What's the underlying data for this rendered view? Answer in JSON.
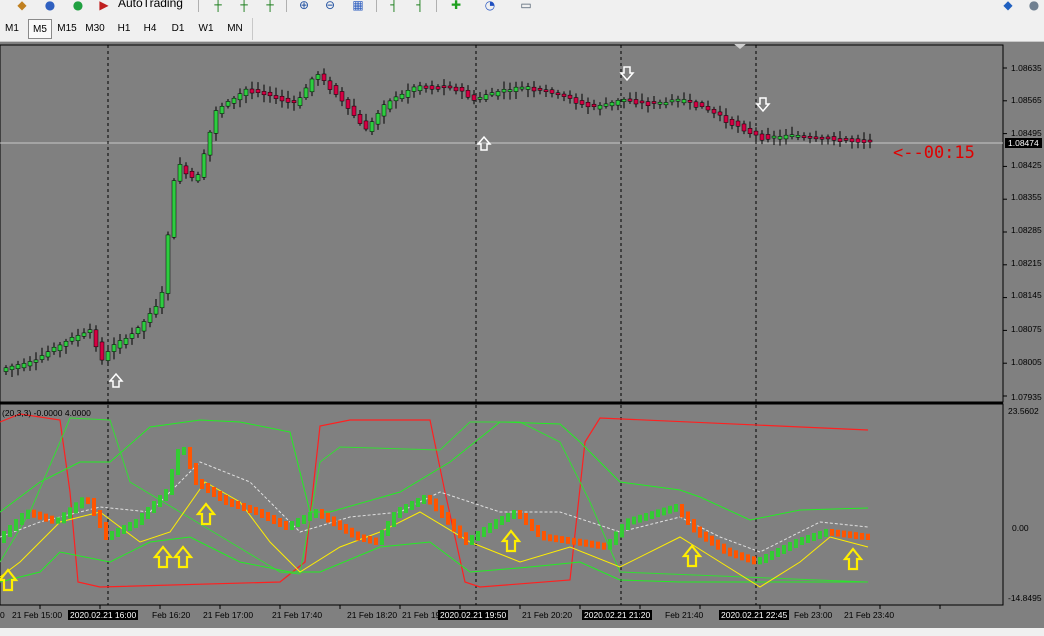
{
  "toolbar": {
    "autotrading_label": "AutoTrading",
    "icons": [
      "new-order-icon",
      "market-watch-icon",
      "navigator-icon",
      "autotrading-icon",
      "bar-chart-icon",
      "candlestick-icon",
      "line-chart-icon",
      "zoom-in-icon",
      "zoom-out-icon",
      "tile-windows-icon",
      "period-separator-icon",
      "chart-shift-icon",
      "indicators-icon",
      "periodicity-icon",
      "templates-icon"
    ]
  },
  "timeframes": [
    "M1",
    "M5",
    "M15",
    "M30",
    "H1",
    "H4",
    "D1",
    "W1",
    "MN"
  ],
  "active_timeframe": "M5",
  "price_axis": {
    "labels": [
      "1.08635",
      "1.08565",
      "1.08495",
      "1.08425",
      "1.08355",
      "1.08285",
      "1.08215",
      "1.08145",
      "1.08075",
      "1.08005",
      "1.07935"
    ],
    "current_price": "1.08474"
  },
  "indicator": {
    "label": "(20,3,3) -0.0000 4.0000",
    "axis_top": "23.5602",
    "axis_zero": "0.00",
    "axis_bottom": "-14.8495"
  },
  "time_axis": {
    "labels": [
      {
        "text": "0",
        "hl": false
      },
      {
        "text": "21 Feb 15:00",
        "hl": false
      },
      {
        "text": "2020.02.21 16:00",
        "hl": true
      },
      {
        "text": "Feb 16:20",
        "hl": false
      },
      {
        "text": "21 Feb 17:00",
        "hl": false
      },
      {
        "text": "21 Feb 17:40",
        "hl": false
      },
      {
        "text": "21 Feb 18:20",
        "hl": false
      },
      {
        "text": "21 Feb 19",
        "hl": false
      },
      {
        "text": "2020.02.21 19:50",
        "hl": true
      },
      {
        "text": "21 Feb 20:20",
        "hl": false
      },
      {
        "text": "2020.02.21 21:20",
        "hl": true
      },
      {
        "text": "Feb 21:40",
        "hl": false
      },
      {
        "text": "2020.02.21 22:45",
        "hl": true
      },
      {
        "text": "Feb 23:00",
        "hl": false
      },
      {
        "text": "21 Feb 23:40",
        "hl": false
      }
    ]
  },
  "countdown": "<--00:15",
  "colors": {
    "chart_bg": "#808080",
    "bull": "#2ecc40",
    "bear": "#d40043",
    "bull_osc": "#33cc33",
    "bear_osc": "#ff5500",
    "band_green": "#22ee22",
    "band_red": "#ff2020",
    "yellow": "#ffee00",
    "countdown": "#e00000"
  }
}
